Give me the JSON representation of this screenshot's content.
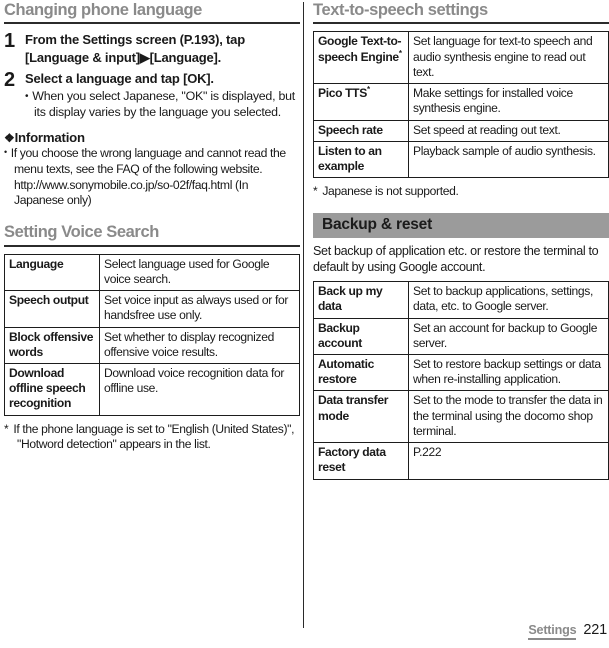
{
  "left_column": {
    "section1": {
      "heading": "Changing phone language",
      "steps": [
        {
          "num": "1",
          "title": "From the Settings screen (P.193), tap [Language & input]▶[Language].",
          "sub": null
        },
        {
          "num": "2",
          "title": "Select a language and tap [OK].",
          "sub": "When you select Japanese, \"OK\" is displayed, but its display varies by the language you selected."
        }
      ],
      "information": {
        "heading": "Information",
        "diamond_icon": "❖",
        "items": [
          "If you choose the wrong language and cannot read the menu texts, see the FAQ of the following website. http://www.sonymobile.co.jp/so-02f/faq.html (In Japanese only)"
        ]
      }
    },
    "section2": {
      "heading": "Setting Voice Search",
      "table": {
        "rows": [
          {
            "key": "Language",
            "key_sup": "",
            "value": "Select language used for Google voice search."
          },
          {
            "key": "Speech output",
            "key_sup": "",
            "value": "Set voice input as always used or for handsfree use only."
          },
          {
            "key": "Block offensive words",
            "key_sup": "",
            "value": "Set whether to display recognized offensive voice results."
          },
          {
            "key": "Download offline speech recognition",
            "key_sup": "",
            "value": "Download voice recognition data for offline use."
          }
        ]
      },
      "footnote": {
        "marker": "*",
        "text": "If the phone language is set to \"English (United States)\", \"Hotword detection\" appears in the list."
      }
    }
  },
  "right_column": {
    "section1": {
      "heading": "Text-to-speech settings",
      "table": {
        "rows": [
          {
            "key": "Google Text-to-speech Engine",
            "key_sup": "*",
            "value": "Set language for text-to speech and audio synthesis engine to read out text."
          },
          {
            "key": "Pico TTS",
            "key_sup": "*",
            "value": "Make settings for installed voice synthesis engine."
          },
          {
            "key": "Speech rate",
            "key_sup": "",
            "value": "Set speed at reading out text."
          },
          {
            "key": "Listen to an example",
            "key_sup": "",
            "value": "Playback sample of audio synthesis."
          }
        ]
      },
      "footnote": {
        "marker": "*",
        "text": "Japanese is not supported."
      }
    },
    "section2": {
      "band_heading": "Backup & reset",
      "intro": "Set backup of application etc. or restore the terminal to default by using Google account.",
      "table": {
        "rows": [
          {
            "key": "Back up my data",
            "key_sup": "",
            "value": "Set to backup applications, settings, data, etc. to Google server."
          },
          {
            "key": "Backup account",
            "key_sup": "",
            "value": "Set an account for backup to Google server."
          },
          {
            "key": "Automatic restore",
            "key_sup": "",
            "value": "Set to restore backup settings or data when re-installing application."
          },
          {
            "key": "Data transfer mode",
            "key_sup": "",
            "value": "Set to the mode to transfer the data in the terminal using the docomo shop terminal."
          },
          {
            "key": "Factory data reset",
            "key_sup": "",
            "value": "P.222"
          }
        ]
      }
    }
  },
  "footer": {
    "chapter": "Settings",
    "page_number": "221"
  },
  "colors": {
    "heading_gray": "#8a8a8a",
    "band_bg": "#9b9b9b",
    "rule_dark": "#2b2b2b",
    "text": "#1a1a1a"
  }
}
